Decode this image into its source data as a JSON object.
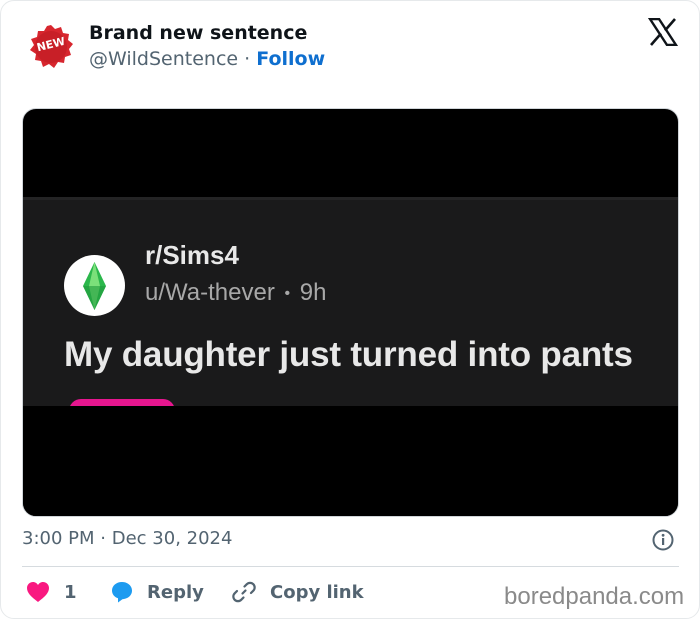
{
  "header": {
    "avatar_badge_text": "NEW",
    "author_name": "Brand new sentence",
    "author_handle": "@WildSentence",
    "separator": "·",
    "follow_label": "Follow",
    "platform_icon": "x-logo-icon"
  },
  "media": {
    "subreddit": "r/Sims4",
    "user": "u/Wa-thever",
    "meta_separator": "•",
    "age": "9h",
    "title": "My daughter just turned into pants",
    "subreddit_icon": "plumbob-icon"
  },
  "footer": {
    "time": "3:00 PM",
    "separator": "·",
    "date": "Dec 30, 2024",
    "info_icon": "info-icon"
  },
  "actions": {
    "like_count": "1",
    "reply_label": "Reply",
    "copy_link_label": "Copy link"
  },
  "watermark": "boredpanda.com",
  "colors": {
    "follow_blue": "#0f6fcf",
    "like_red": "#f91880",
    "reply_blue": "#1d9bf0",
    "badge_red": "#d7262e",
    "accent_pink": "#e6168f"
  }
}
